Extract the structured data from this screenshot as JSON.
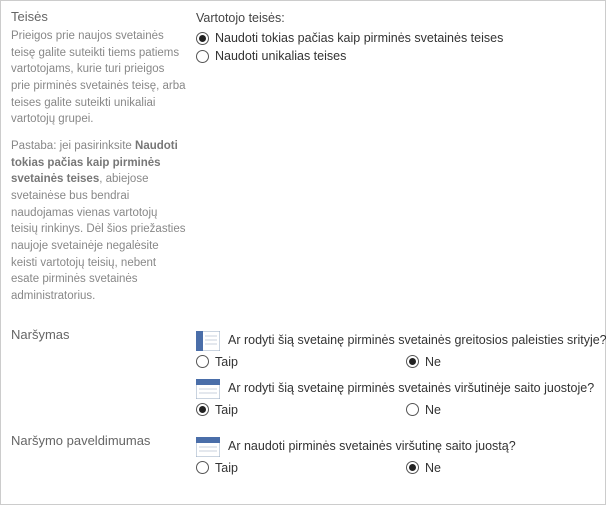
{
  "permissions": {
    "title": "Teisės",
    "desc1": "Prieigos prie naujos svetainės teisę galite suteikti tiems patiems vartotojams, kurie turi prieigos prie pirminės svetainės teisę, arba teises galite suteikti unikaliai vartotojų grupei.",
    "desc2_prefix": "Pastaba: jei pasirinksite ",
    "desc2_bold": "Naudoti tokias pačias kaip pirminės svetainės teises",
    "desc2_suffix": ", abiejose svetainėse bus bendrai naudojamas vienas vartotojų teisių rinkinys. Dėl šios priežasties naujoje svetainėje negalėsite keisti vartotojų teisių, nebent esate pirminės svetainės administratorius.",
    "field_label": "Vartotojo teisės:",
    "opt_same": "Naudoti tokias pačias kaip pirminės svetainės teises",
    "opt_unique": "Naudoti unikalias teises",
    "selected": "same"
  },
  "navigation": {
    "title": "Naršymas",
    "q1": "Ar rodyti šią svetainę pirminės svetainės greitosios paleisties srityje?",
    "q1_selected": "no",
    "q2": "Ar rodyti šią svetainę pirminės svetainės viršutinėje saito juostoje?",
    "q2_selected": "yes"
  },
  "nav_inherit": {
    "title": "Naršymo paveldimumas",
    "q1": "Ar naudoti pirminės svetainės viršutinę saito juostą?",
    "q1_selected": "no"
  },
  "common": {
    "yes": "Taip",
    "no": "Ne"
  }
}
